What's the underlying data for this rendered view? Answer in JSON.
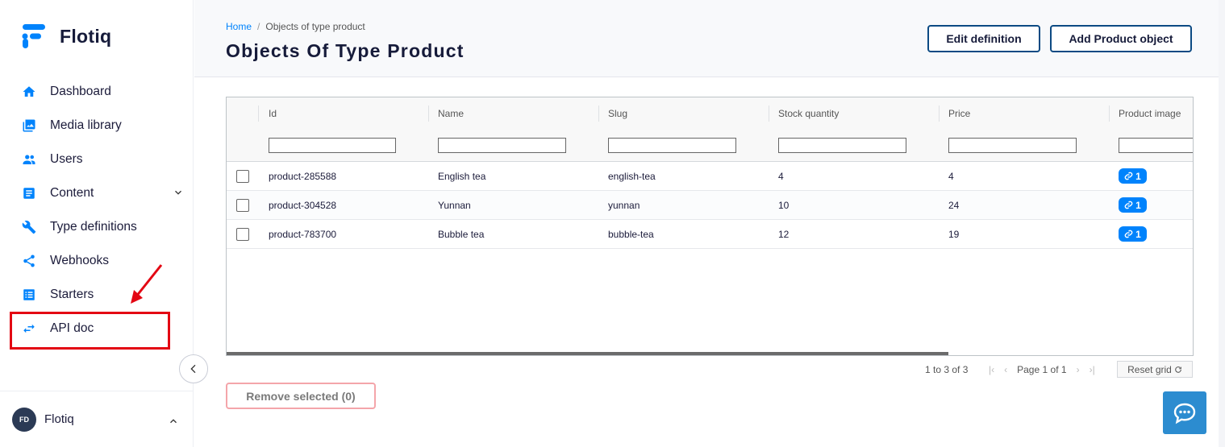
{
  "app": {
    "name": "Flotiq"
  },
  "sidebar": {
    "items": [
      {
        "label": "Dashboard",
        "icon": "home-icon"
      },
      {
        "label": "Media library",
        "icon": "media-icon"
      },
      {
        "label": "Users",
        "icon": "users-icon"
      },
      {
        "label": "Content",
        "icon": "content-icon"
      },
      {
        "label": "Type definitions",
        "icon": "wrench-icon"
      },
      {
        "label": "Webhooks",
        "icon": "share-icon"
      },
      {
        "label": "Starters",
        "icon": "list-icon"
      },
      {
        "label": "API doc",
        "icon": "swap-icon"
      }
    ],
    "user": {
      "initials": "FD",
      "name": "Flotiq"
    }
  },
  "header": {
    "breadcrumb": {
      "home": "Home",
      "separator": "/",
      "current": "Objects of type product"
    },
    "title": "Objects Of Type Product",
    "edit_label": "Edit definition",
    "add_label": "Add Product object"
  },
  "grid": {
    "columns": [
      "Id",
      "Name",
      "Slug",
      "Stock quantity",
      "Price",
      "Product image"
    ],
    "rows": [
      {
        "id": "product-285588",
        "name": "English tea",
        "slug": "english-tea",
        "stock": "4",
        "price": "4",
        "images": "1"
      },
      {
        "id": "product-304528",
        "name": "Yunnan",
        "slug": "yunnan",
        "stock": "10",
        "price": "24",
        "images": "1"
      },
      {
        "id": "product-783700",
        "name": "Bubble tea",
        "slug": "bubble-tea",
        "stock": "12",
        "price": "19",
        "images": "1"
      }
    ]
  },
  "pagination": {
    "summary": "1 to 3 of 3",
    "page_prefix": "Page",
    "page": "1",
    "of": "of",
    "total_pages": "1",
    "reset_label": "Reset grid"
  },
  "actions": {
    "remove_label": "Remove selected (0)"
  },
  "colors": {
    "accent": "#0083fc",
    "primary_dark": "#0c4a83",
    "highlight": "#e30613",
    "chat": "#2c8cd0"
  }
}
